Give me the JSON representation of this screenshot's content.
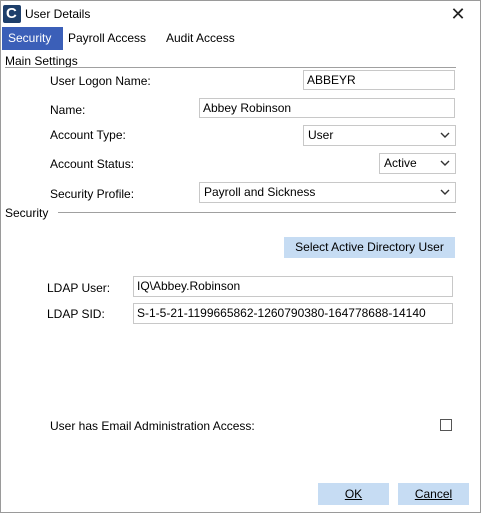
{
  "window": {
    "title": "User Details"
  },
  "tabs": [
    {
      "label": "Security",
      "active": true
    },
    {
      "label": "Payroll Access",
      "active": false
    },
    {
      "label": "Audit Access",
      "active": false
    }
  ],
  "main_settings": {
    "heading": "Main Settings",
    "user_logon_name_label": "User Logon Name:",
    "user_logon_name_value": "ABBEYR",
    "name_label": "Name:",
    "name_value": "Abbey Robinson",
    "account_type_label": "Account Type:",
    "account_type_value": "User",
    "account_status_label": "Account Status:",
    "account_status_value": "Active",
    "security_profile_label": "Security Profile:",
    "security_profile_value": "Payroll and Sickness"
  },
  "security": {
    "heading": "Security",
    "select_ad_button": "Select Active Directory User",
    "ldap_user_label": "LDAP User:",
    "ldap_user_value": "IQ\\Abbey.Robinson",
    "ldap_sid_label": "LDAP SID:",
    "ldap_sid_value": "S-1-5-21-1199665862-1260790380-164778688-14140",
    "email_admin_label": "User has Email Administration Access:",
    "email_admin_checked": false
  },
  "footer": {
    "ok_label": "OK",
    "cancel_label": "Cancel"
  },
  "colors": {
    "active_tab": "#3b5fb8",
    "button_bg": "#c6dcf3",
    "app_icon": "#1e3f6b"
  },
  "icons": {
    "app": "app-logo-icon",
    "close": "close-icon",
    "dropdown": "chevron-down-icon"
  }
}
